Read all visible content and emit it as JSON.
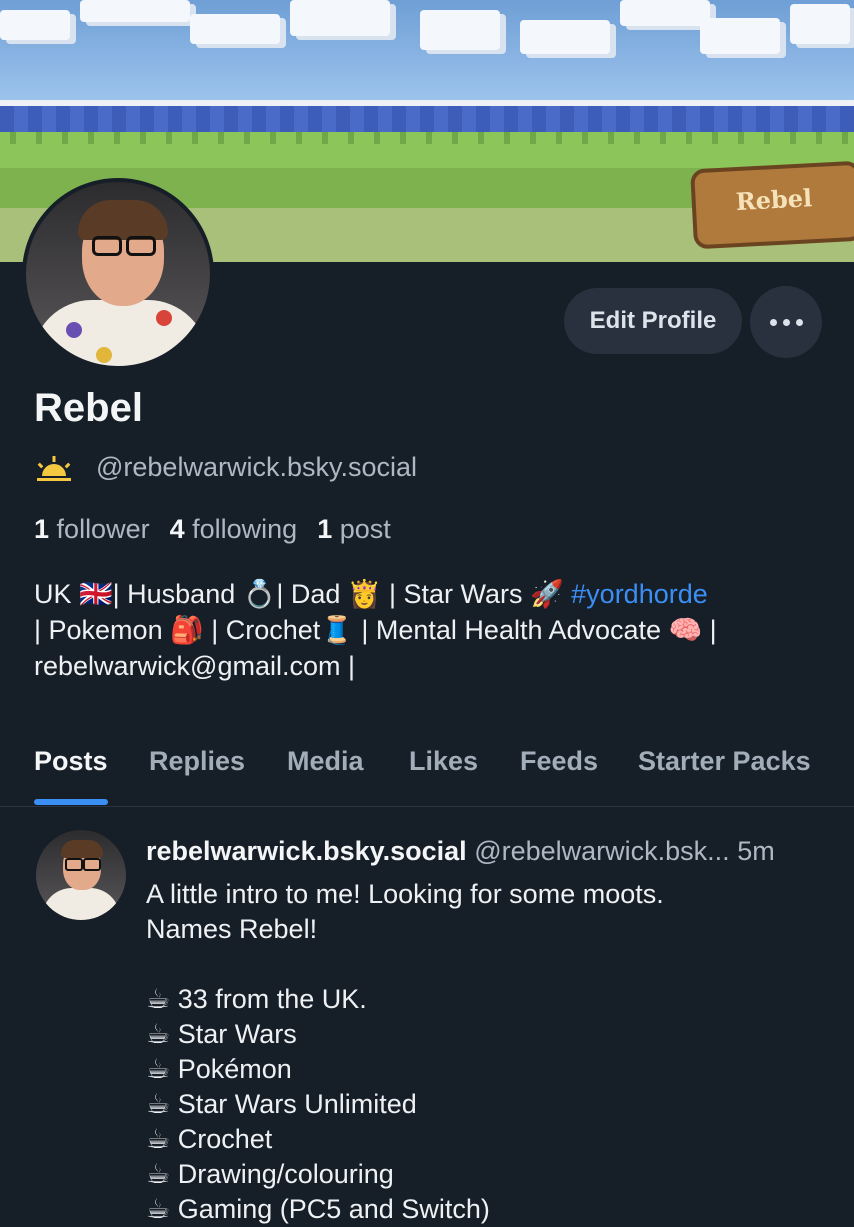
{
  "banner": {
    "sign_text": "Rebel"
  },
  "profile": {
    "display_name": "Rebel",
    "handle": "@rebelwarwick.bsky.social",
    "followers_count": "1",
    "followers_label": "follower",
    "following_count": "4",
    "following_label": "following",
    "posts_count": "1",
    "posts_label": "post",
    "edit_button": "Edit Profile",
    "bio_lines": [
      [
        "UK 🇬🇧| Husband 💍| Dad 👸 | Star Wars 🚀 ",
        "#yordhorde"
      ],
      [
        "| Pokemon 🎒 | Crochet🧵 | Mental Health Advocate 🧠 |",
        ""
      ],
      [
        "rebelwarwick@gmail.com |",
        ""
      ]
    ]
  },
  "tabs": [
    "Posts",
    "Replies",
    "Media",
    "Likes",
    "Feeds",
    "Starter Packs"
  ],
  "active_tab": "Posts",
  "post": {
    "author": "rebelwarwick.bsky.social",
    "handle": "@rebelwarwick.bsk...",
    "time": "5m",
    "lines": [
      "A little intro to me! Looking for some moots.",
      "Names Rebel!",
      "",
      "☕ 33 from the UK.",
      "☕ Star Wars",
      "☕ Pokémon",
      "☕ Star Wars Unlimited",
      "☕ Crochet",
      "☕ Drawing/colouring",
      "☕ Gaming (PC5 and Switch)"
    ]
  },
  "colors": {
    "background": "#161e27",
    "accent": "#3b8ff4",
    "button": "#28313d"
  }
}
